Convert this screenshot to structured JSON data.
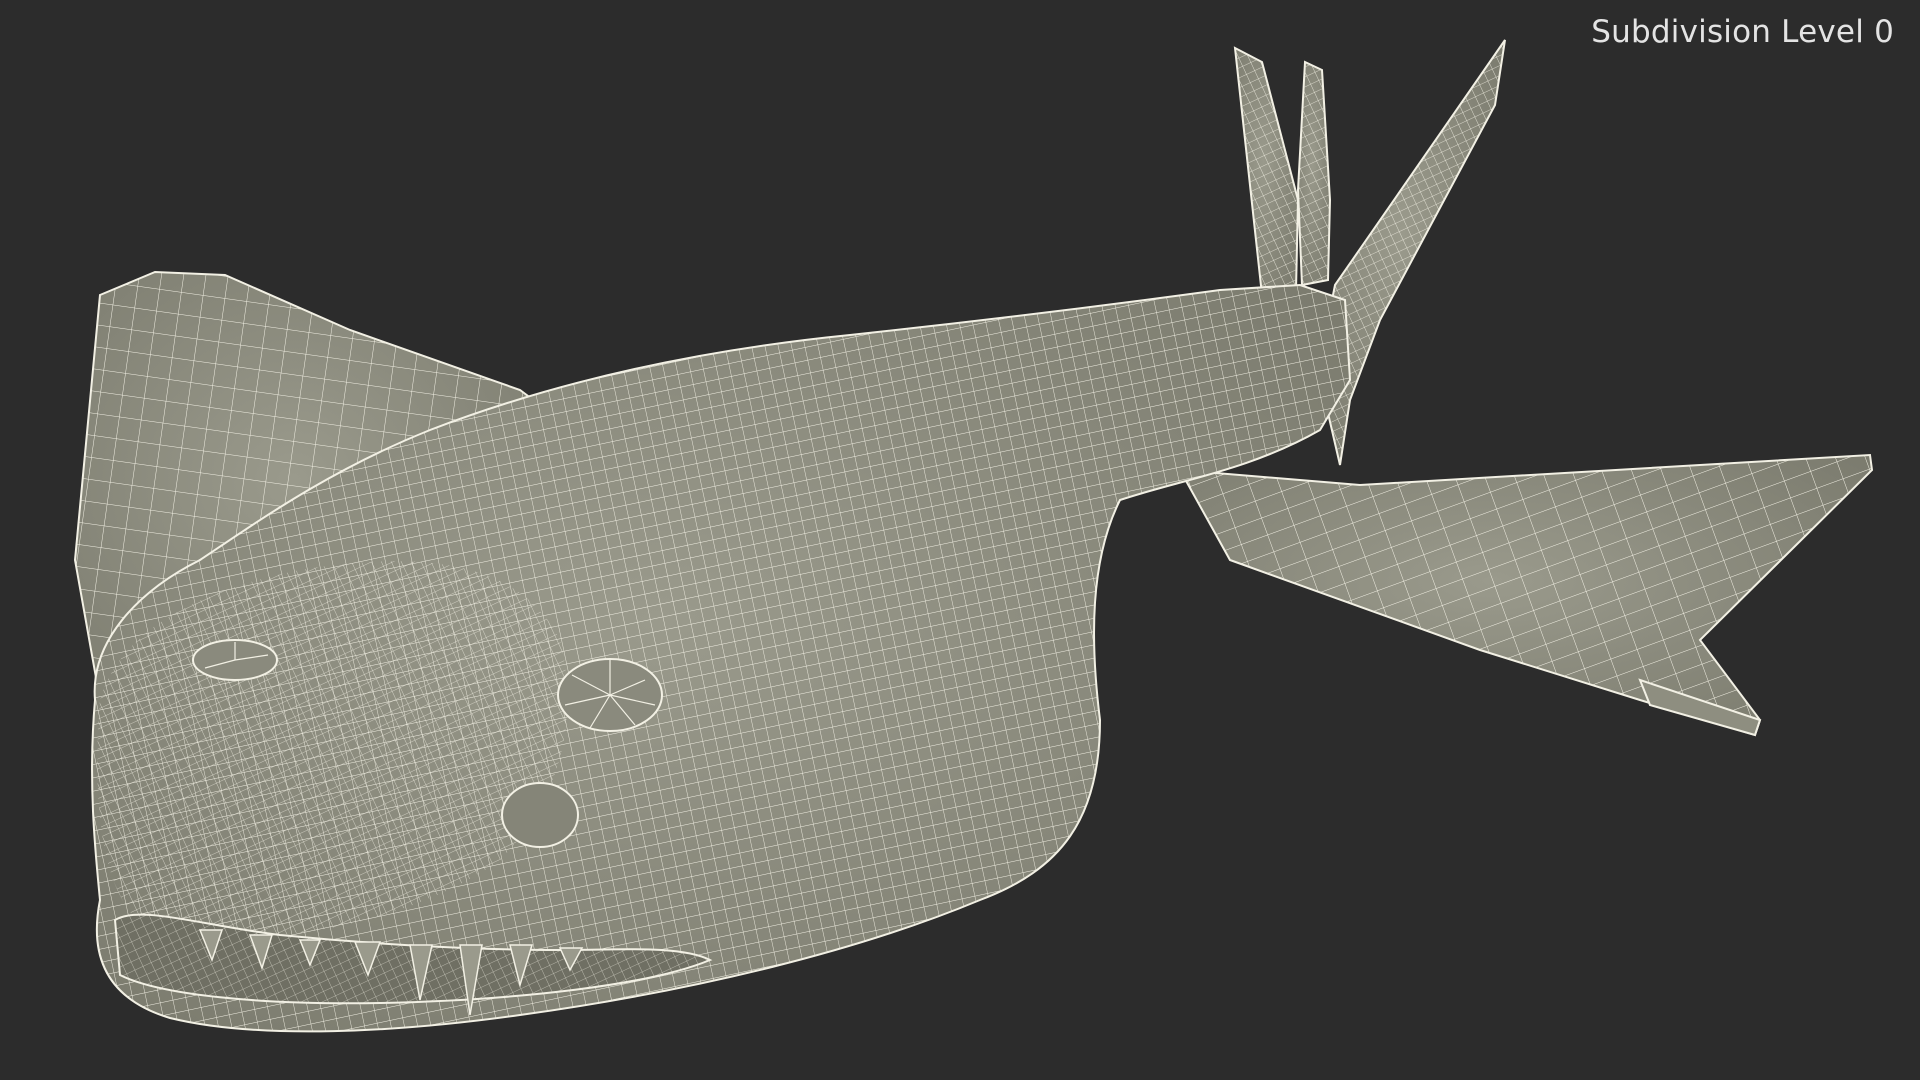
{
  "viewport": {
    "label": "Subdivision Level 0",
    "background_color": "#2c2c2c",
    "mesh_fill_color": "#8e8e80",
    "mesh_wire_color": "#f2f0e4"
  },
  "model": {
    "icon": "shark-wireframe-mesh"
  }
}
